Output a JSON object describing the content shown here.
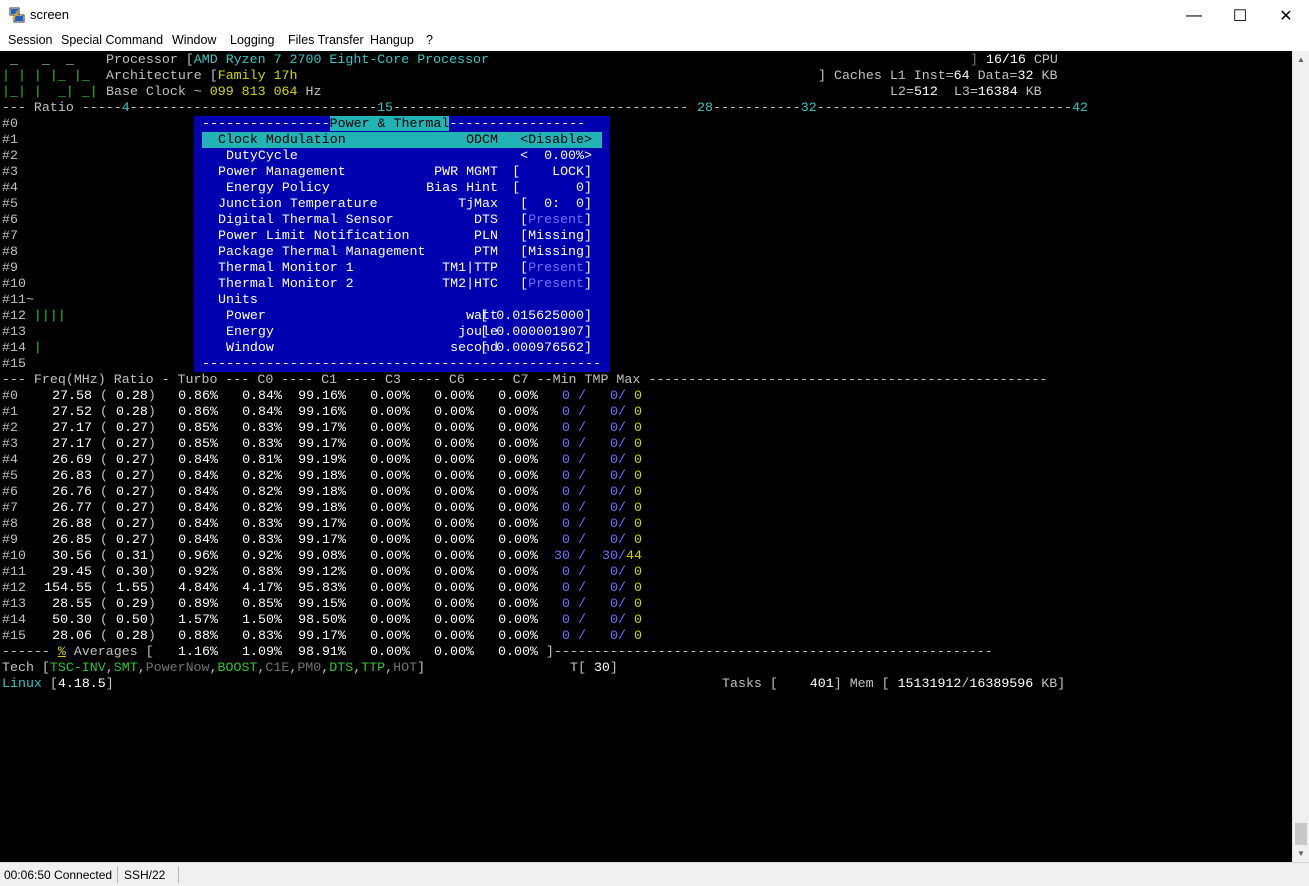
{
  "window": {
    "title": "screen",
    "minimize": "—",
    "maximize": "☐",
    "close": "✕",
    "icon": "putty-icon"
  },
  "menu": [
    "Session",
    "Special Command",
    "Window",
    "Logging",
    "Files Transfer",
    "Hangup",
    "?"
  ],
  "status": {
    "time_state": "00:06:50 Connected",
    "protocol": "SSH/22"
  },
  "header": {
    "logo": [
      " _   _  _",
      "| | | |_ |_",
      "|_| |  _| _|"
    ],
    "processor_label": "Processor [",
    "processor": "AMD Ryzen 7 2700 Eight-Core Processor",
    "cpu_count": "16/16",
    "cpu_suffix": " CPU",
    "arch_label": "Architecture [",
    "arch": "Family 17h",
    "caches_label": "] Caches L1 Inst=",
    "l1_inst": "64",
    "l1_data_label": " Data=",
    "l1_data": "32",
    "kb": " KB",
    "clock_label": "Base Clock ~ ",
    "clock": "099 813 064",
    "hz": " Hz",
    "l2_label": "L2=",
    "l2": "512",
    "l3_label": "  L3=",
    "l3": "16384",
    "kb2": " KB"
  },
  "ratio_ruler": {
    "label": "--- Ratio -----",
    "marks": [
      "4",
      "15",
      "28",
      "32",
      "42"
    ]
  },
  "core_labels": [
    "#0",
    "#1",
    "#2",
    "#3",
    "#4",
    "#5",
    "#6",
    "#7",
    "#8",
    "#9",
    "#10",
    "#11~",
    "#12",
    "#13",
    "#14",
    "#15"
  ],
  "core_bars": {
    "12": " ||||",
    "14": " |"
  },
  "popup": {
    "title": "Power & Thermal",
    "rows": [
      {
        "label": "Clock Modulation",
        "key": "ODCM",
        "value": "<Disable>",
        "value_color": "sel",
        "selected": true
      },
      {
        "label": " DutyCycle",
        "key": "",
        "value": "<  0.00%>",
        "value_color": "w"
      },
      {
        "label": "Power Management",
        "key": "PWR MGMT",
        "value": "[    LOCK]",
        "value_color": "w"
      },
      {
        "label": " Energy Policy",
        "key": "Bias Hint",
        "value": "[       0]",
        "value_color": "w"
      },
      {
        "label": "Junction Temperature",
        "key": "TjMax",
        "value": "[  0:  0]",
        "value_color": "w"
      },
      {
        "label": "Digital Thermal Sensor",
        "key": "DTS",
        "value": "Present",
        "value_color": "bl"
      },
      {
        "label": "Power Limit Notification",
        "key": "PLN",
        "value": "Missing",
        "value_color": "w"
      },
      {
        "label": "Package Thermal Management",
        "key": "PTM",
        "value": "Missing",
        "value_color": "w"
      },
      {
        "label": "Thermal Monitor 1",
        "key": "TM1|TTP",
        "value": "Present",
        "value_color": "bl"
      },
      {
        "label": "Thermal Monitor 2",
        "key": "TM2|HTC",
        "value": "Present",
        "value_color": "bl"
      },
      {
        "label": "Units",
        "key": "",
        "value": "",
        "value_color": "w"
      },
      {
        "label": " Power",
        "key": "watt",
        "value": "[ 0.015625000]",
        "value_color": "w"
      },
      {
        "label": " Energy",
        "key": "joule",
        "value": "[ 0.000001907]",
        "value_color": "w"
      },
      {
        "label": " Window",
        "key": "second",
        "value": "[ 0.000976562]",
        "value_color": "w"
      }
    ]
  },
  "freq_header": "--- Freq(MHz) Ratio - Turbo --- C0 ---- C1 ---- C3 ---- C6 ---- C7 --Min TMP Max ",
  "cores": [
    {
      "id": "#0",
      "freq": "27.58",
      "ratio": "0.28",
      "turbo": "0.86%",
      "c0": "0.84%",
      "c1": "99.16%",
      "c3": "0.00%",
      "c6": "0.00%",
      "c7": "0.00%",
      "min": "0",
      "tmp": "0",
      "max": "0"
    },
    {
      "id": "#1",
      "freq": "27.52",
      "ratio": "0.28",
      "turbo": "0.86%",
      "c0": "0.84%",
      "c1": "99.16%",
      "c3": "0.00%",
      "c6": "0.00%",
      "c7": "0.00%",
      "min": "0",
      "tmp": "0",
      "max": "0"
    },
    {
      "id": "#2",
      "freq": "27.17",
      "ratio": "0.27",
      "turbo": "0.85%",
      "c0": "0.83%",
      "c1": "99.17%",
      "c3": "0.00%",
      "c6": "0.00%",
      "c7": "0.00%",
      "min": "0",
      "tmp": "0",
      "max": "0"
    },
    {
      "id": "#3",
      "freq": "27.17",
      "ratio": "0.27",
      "turbo": "0.85%",
      "c0": "0.83%",
      "c1": "99.17%",
      "c3": "0.00%",
      "c6": "0.00%",
      "c7": "0.00%",
      "min": "0",
      "tmp": "0",
      "max": "0"
    },
    {
      "id": "#4",
      "freq": "26.69",
      "ratio": "0.27",
      "turbo": "0.84%",
      "c0": "0.81%",
      "c1": "99.19%",
      "c3": "0.00%",
      "c6": "0.00%",
      "c7": "0.00%",
      "min": "0",
      "tmp": "0",
      "max": "0"
    },
    {
      "id": "#5",
      "freq": "26.83",
      "ratio": "0.27",
      "turbo": "0.84%",
      "c0": "0.82%",
      "c1": "99.18%",
      "c3": "0.00%",
      "c6": "0.00%",
      "c7": "0.00%",
      "min": "0",
      "tmp": "0",
      "max": "0"
    },
    {
      "id": "#6",
      "freq": "26.76",
      "ratio": "0.27",
      "turbo": "0.84%",
      "c0": "0.82%",
      "c1": "99.18%",
      "c3": "0.00%",
      "c6": "0.00%",
      "c7": "0.00%",
      "min": "0",
      "tmp": "0",
      "max": "0"
    },
    {
      "id": "#7",
      "freq": "26.77",
      "ratio": "0.27",
      "turbo": "0.84%",
      "c0": "0.82%",
      "c1": "99.18%",
      "c3": "0.00%",
      "c6": "0.00%",
      "c7": "0.00%",
      "min": "0",
      "tmp": "0",
      "max": "0"
    },
    {
      "id": "#8",
      "freq": "26.88",
      "ratio": "0.27",
      "turbo": "0.84%",
      "c0": "0.83%",
      "c1": "99.17%",
      "c3": "0.00%",
      "c6": "0.00%",
      "c7": "0.00%",
      "min": "0",
      "tmp": "0",
      "max": "0"
    },
    {
      "id": "#9",
      "freq": "26.85",
      "ratio": "0.27",
      "turbo": "0.84%",
      "c0": "0.83%",
      "c1": "99.17%",
      "c3": "0.00%",
      "c6": "0.00%",
      "c7": "0.00%",
      "min": "0",
      "tmp": "0",
      "max": "0"
    },
    {
      "id": "#10",
      "freq": "30.56",
      "ratio": "0.31",
      "turbo": "0.96%",
      "c0": "0.92%",
      "c1": "99.08%",
      "c3": "0.00%",
      "c6": "0.00%",
      "c7": "0.00%",
      "min": "30",
      "tmp": "30",
      "max": "44"
    },
    {
      "id": "#11",
      "freq": "29.45",
      "ratio": "0.30",
      "turbo": "0.92%",
      "c0": "0.88%",
      "c1": "99.12%",
      "c3": "0.00%",
      "c6": "0.00%",
      "c7": "0.00%",
      "min": "0",
      "tmp": "0",
      "max": "0"
    },
    {
      "id": "#12",
      "freq": "154.55",
      "ratio": "1.55",
      "turbo": "4.84%",
      "c0": "4.17%",
      "c1": "95.83%",
      "c3": "0.00%",
      "c6": "0.00%",
      "c7": "0.00%",
      "min": "0",
      "tmp": "0",
      "max": "0"
    },
    {
      "id": "#13",
      "freq": "28.55",
      "ratio": "0.29",
      "turbo": "0.89%",
      "c0": "0.85%",
      "c1": "99.15%",
      "c3": "0.00%",
      "c6": "0.00%",
      "c7": "0.00%",
      "min": "0",
      "tmp": "0",
      "max": "0"
    },
    {
      "id": "#14",
      "freq": "50.30",
      "ratio": "0.50",
      "turbo": "1.57%",
      "c0": "1.50%",
      "c1": "98.50%",
      "c3": "0.00%",
      "c6": "0.00%",
      "c7": "0.00%",
      "min": "0",
      "tmp": "0",
      "max": "0"
    },
    {
      "id": "#15",
      "freq": "28.06",
      "ratio": "0.28",
      "turbo": "0.88%",
      "c0": "0.83%",
      "c1": "99.17%",
      "c3": "0.00%",
      "c6": "0.00%",
      "c7": "0.00%",
      "min": "0",
      "tmp": "0",
      "max": "0"
    }
  ],
  "averages": {
    "prefix": "------ ",
    "pct": "%",
    "label": " Averages [",
    "turbo": "1.16%",
    "c0": "1.09%",
    "c1": "98.91%",
    "c3": "0.00%",
    "c6": "0.00%",
    "c7": "0.00%",
    "close": " ]"
  },
  "tech": {
    "label": "Tech [",
    "items": [
      {
        "text": "TSC-INV",
        "color": "gr"
      },
      {
        "text": ",",
        "color": "g"
      },
      {
        "text": "SMT",
        "color": "gr"
      },
      {
        "text": ",",
        "color": "g"
      },
      {
        "text": "PowerNow",
        "color": "dg"
      },
      {
        "text": ",",
        "color": "g"
      },
      {
        "text": "BOOST",
        "color": "gr"
      },
      {
        "text": ",",
        "color": "g"
      },
      {
        "text": "C1E",
        "color": "dg"
      },
      {
        "text": ",",
        "color": "g"
      },
      {
        "text": "PM0",
        "color": "dg"
      },
      {
        "text": ",",
        "color": "g"
      },
      {
        "text": "DTS",
        "color": "gr"
      },
      {
        "text": ",",
        "color": "g"
      },
      {
        "text": "TTP",
        "color": "gr"
      },
      {
        "text": ",",
        "color": "g"
      },
      {
        "text": "HOT",
        "color": "dg"
      },
      {
        "text": "]",
        "color": "g"
      }
    ],
    "temp_label": "T[ ",
    "temp": "30",
    "temp_close": "]"
  },
  "footer": {
    "os": "Linux",
    "kernel": "4.18.5",
    "tasks_label": "Tasks [",
    "tasks": "401",
    "mem_label": "] Mem [",
    "mem_used": "15131912",
    "mem_total": "16389596",
    "mem_unit": " KB]"
  }
}
